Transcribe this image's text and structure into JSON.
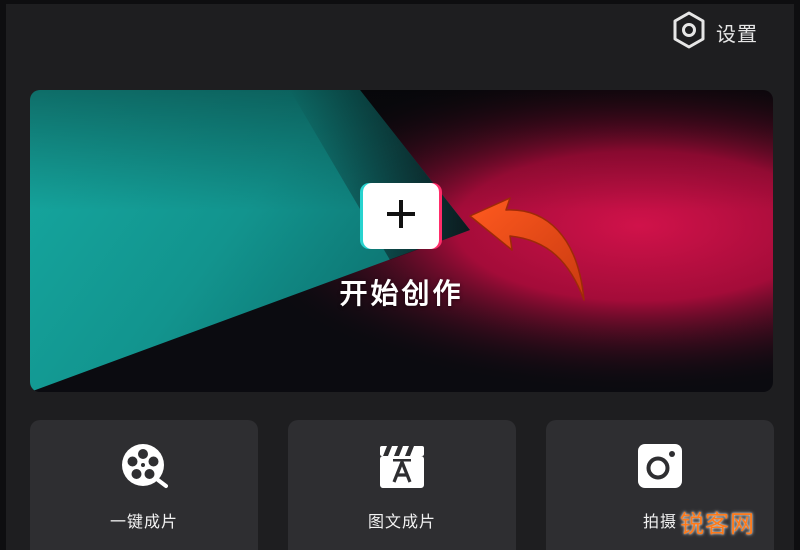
{
  "settings": {
    "label": "设置",
    "icon": "hexagon-gear-icon"
  },
  "hero": {
    "title": "开始创作",
    "icon": "plus-icon",
    "annotation_icon": "curved-arrow-icon",
    "colors": {
      "teal": "#1aa39c",
      "pink": "#c8103f",
      "dark": "#0b0b10",
      "arrow": "#e0441a"
    }
  },
  "tiles": [
    {
      "label": "一键成片",
      "icon": "film-reel-icon"
    },
    {
      "label": "图文成片",
      "icon": "clapperboard-a-icon"
    },
    {
      "label": "拍摄",
      "icon": "camera-icon"
    }
  ],
  "watermark": {
    "text": "锐客网",
    "color": "#ff7a1a"
  }
}
